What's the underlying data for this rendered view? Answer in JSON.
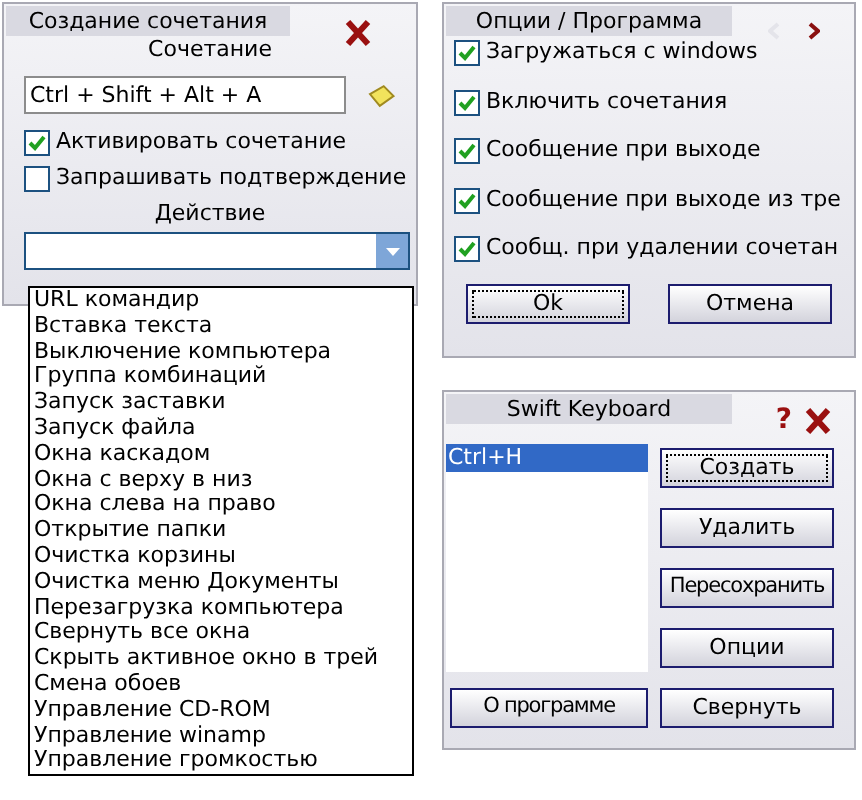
{
  "create_panel": {
    "title": "Создание сочетания",
    "combination_label": "Сочетание",
    "combination_value": "Ctrl + Shift + Alt + A",
    "checkboxes": [
      {
        "label": "Активировать сочетание",
        "checked": true
      },
      {
        "label": "Запрашивать подтверждение",
        "checked": false
      }
    ],
    "action_label": "Действие",
    "action_dropdown": {
      "expanded": true,
      "options": [
        "URL командир",
        "Вставка текста",
        "Выключение компьютера",
        "Группа комбинаций",
        "Запуск заставки",
        "Запуск файла",
        "Окна каскадом",
        "Окна с верху в низ",
        "Окна слева на право",
        "Открытие папки",
        "Очистка корзины",
        "Очистка меню Документы",
        "Перезагрузка компьютера",
        "Свернуть все окна",
        "Скрыть активное окно в трей",
        "Смена обоев",
        "Управление CD-ROM",
        "Управление winamp",
        "Управление громкостью"
      ]
    }
  },
  "options_panel": {
    "title": "Опции / Программа",
    "prev_disabled": true,
    "checkboxes": [
      {
        "label": "Загружаться с windows",
        "checked": true
      },
      {
        "label": "Включить сочетания",
        "checked": true
      },
      {
        "label": "Сообщение при выходе",
        "checked": true
      },
      {
        "label": "Сообщение при выходе из тре",
        "checked": true
      },
      {
        "label": "Сообщ. при удалении сочетан",
        "checked": true
      }
    ],
    "buttons": [
      {
        "label": "Ok",
        "focused": true
      },
      {
        "label": "Отмена",
        "focused": false
      }
    ]
  },
  "main_panel": {
    "title": "Swift Keyboard",
    "help": "?",
    "shortcuts": [
      {
        "label": "Ctrl+H",
        "selected": true
      }
    ],
    "buttons": [
      {
        "label": "Создать",
        "focused": true
      },
      {
        "label": "Удалить",
        "focused": false
      },
      {
        "label": "Пересохранить",
        "focused": false
      },
      {
        "label": "Опции",
        "focused": false
      }
    ],
    "bottom_buttons": [
      {
        "label": "О программе",
        "focused": false
      },
      {
        "label": "Свернуть",
        "focused": false
      }
    ]
  }
}
